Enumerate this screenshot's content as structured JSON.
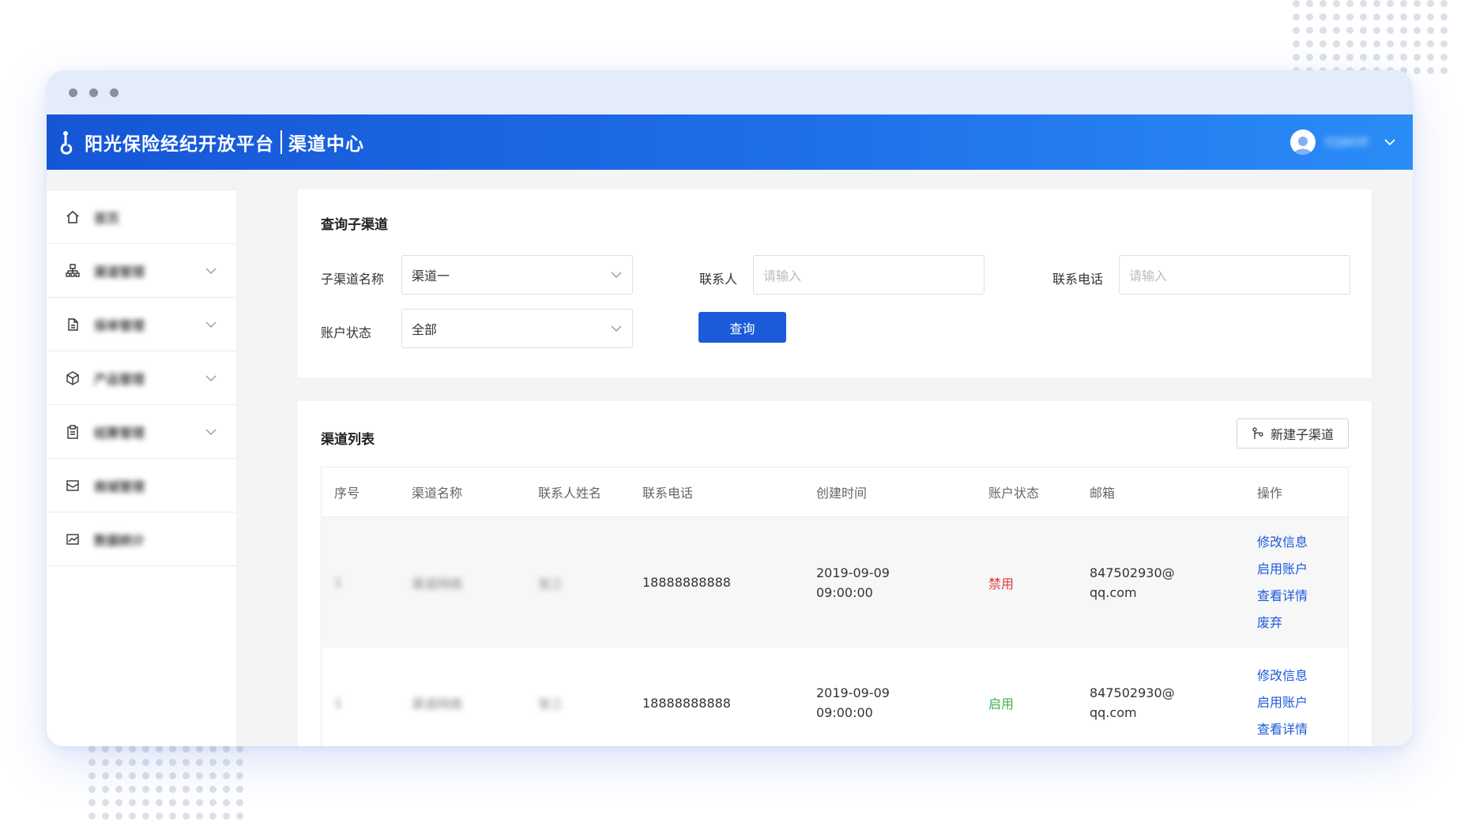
{
  "header": {
    "brand": "阳光保险经纪开放平台",
    "section": "渠道中心",
    "username": "FDMYP"
  },
  "sidebar": {
    "items": [
      {
        "label": "首页",
        "icon": "home-icon",
        "expandable": false
      },
      {
        "label": "渠道管理",
        "icon": "org-icon",
        "expandable": true
      },
      {
        "label": "保单管理",
        "icon": "document-icon",
        "expandable": true
      },
      {
        "label": "产品管理",
        "icon": "cube-icon",
        "expandable": true
      },
      {
        "label": "结算管理",
        "icon": "clipboard-icon",
        "expandable": true
      },
      {
        "label": "商城管理",
        "icon": "mail-icon",
        "expandable": false
      },
      {
        "label": "数据统计",
        "icon": "chart-icon",
        "expandable": false
      }
    ]
  },
  "query": {
    "title": "查询子渠道",
    "name_label": "子渠道名称",
    "name_value": "渠道一",
    "contact_label": "联系人",
    "contact_placeholder": "请输入",
    "phone_label": "联系电话",
    "phone_placeholder": "请输入",
    "status_label": "账户状态",
    "status_value": "全部",
    "search_button": "查询"
  },
  "list": {
    "title": "渠道列表",
    "new_button": "新建子渠道",
    "columns": [
      "序号",
      "渠道名称",
      "联系人姓名",
      "联系电话",
      "创建时间",
      "账户状态",
      "邮箱",
      "操作"
    ],
    "rows": [
      {
        "index": "1",
        "name": "渠道网络",
        "contact": "张三",
        "phone": "18888888888",
        "date": "2019-09-09",
        "time": "09:00:00",
        "status": "禁用",
        "status_color": "#e03a3a",
        "email_1": "847502930@",
        "email_2": "qq.com",
        "ops": [
          "修改信息",
          "启用账户",
          "查看详情",
          "废弃"
        ]
      },
      {
        "index": "1",
        "name": "渠道网络",
        "contact": "张三",
        "phone": "18888888888",
        "date": "2019-09-09",
        "time": "09:00:00",
        "status": "启用",
        "status_color": "#3bb34a",
        "email_1": "847502930@",
        "email_2": "qq.com",
        "ops": [
          "修改信息",
          "启用账户",
          "查看详情"
        ]
      }
    ]
  }
}
